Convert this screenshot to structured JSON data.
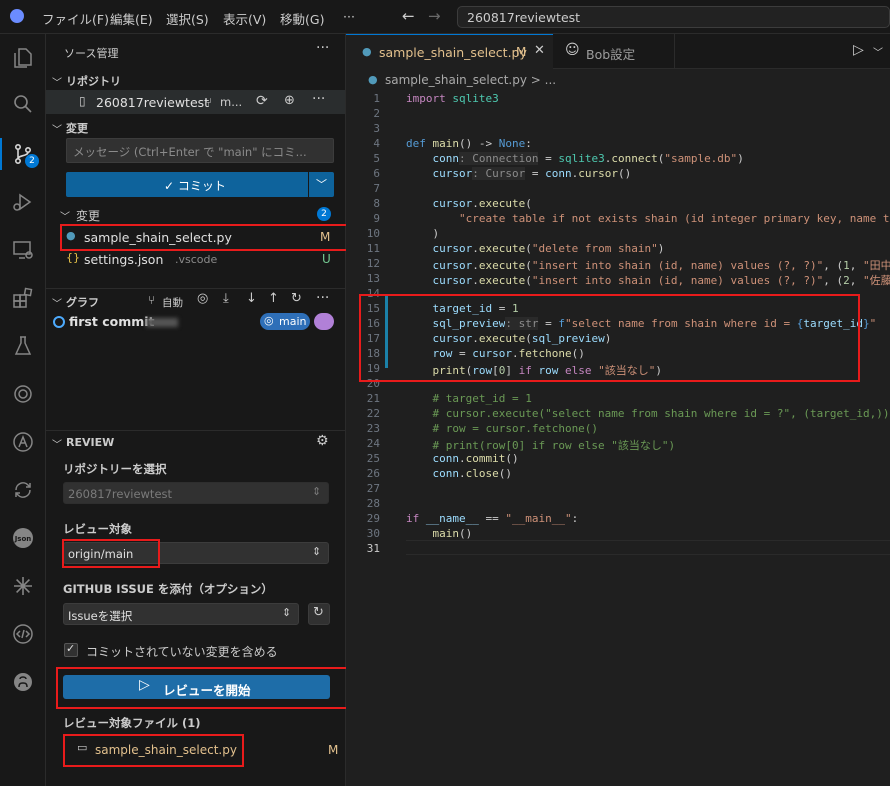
{
  "titlebar": {
    "menus": [
      "ファイル(F)",
      "編集(E)",
      "選択(S)",
      "表示(V)",
      "移動(G)",
      "···"
    ],
    "search_text": "260817reviewtest"
  },
  "activity": {
    "scm_badge": "2"
  },
  "scm": {
    "title": "ソース管理",
    "repos_header": "リポジトリ",
    "repo_name": "260817reviewtest",
    "repo_branch": "m...",
    "changes_header": "変更",
    "message_placeholder": "メッセージ (Ctrl+Enter で \"main\" にコミ...",
    "commit_label": "✓ コミット",
    "changes_group": "変更",
    "changes_count": "2",
    "files": [
      {
        "name": "sample_shain_select.py",
        "dir": "",
        "status": "M"
      },
      {
        "name": "settings.json",
        "dir": ".vscode",
        "status": "U"
      }
    ],
    "graph_header": "グラフ",
    "graph_auto": "自動",
    "commit_msg": "first commit",
    "branch_tag": "main"
  },
  "review": {
    "header": "REVIEW",
    "repo_label": "リポジトリーを選択",
    "repo_value": "260817reviewtest",
    "target_label": "レビュー対象",
    "target_value": "origin/main",
    "issue_label": "GITHUB ISSUE を添付（オプション）",
    "issue_value": "Issueを選択",
    "checkbox_label": "コミットされていない変更を含める",
    "start_label": "レビューを開始",
    "files_label": "レビュー対象ファイル (1)",
    "file_name": "sample_shain_select.py",
    "file_status": "M"
  },
  "editor": {
    "tab1_name": "sample_shain_select.py",
    "tab1_status": "M",
    "tab2_name": "Bob設定",
    "breadcrumb": "sample_shain_select.py > ...",
    "line_numbers": [
      "1",
      "2",
      "3",
      "4",
      "5",
      "6",
      "7",
      "8",
      "9",
      "10",
      "11",
      "12",
      "13",
      "14",
      "15",
      "16",
      "17",
      "18",
      "19",
      "20",
      "21",
      "22",
      "23",
      "24",
      "25",
      "26",
      "27",
      "28",
      "29",
      "30",
      "31"
    ]
  }
}
